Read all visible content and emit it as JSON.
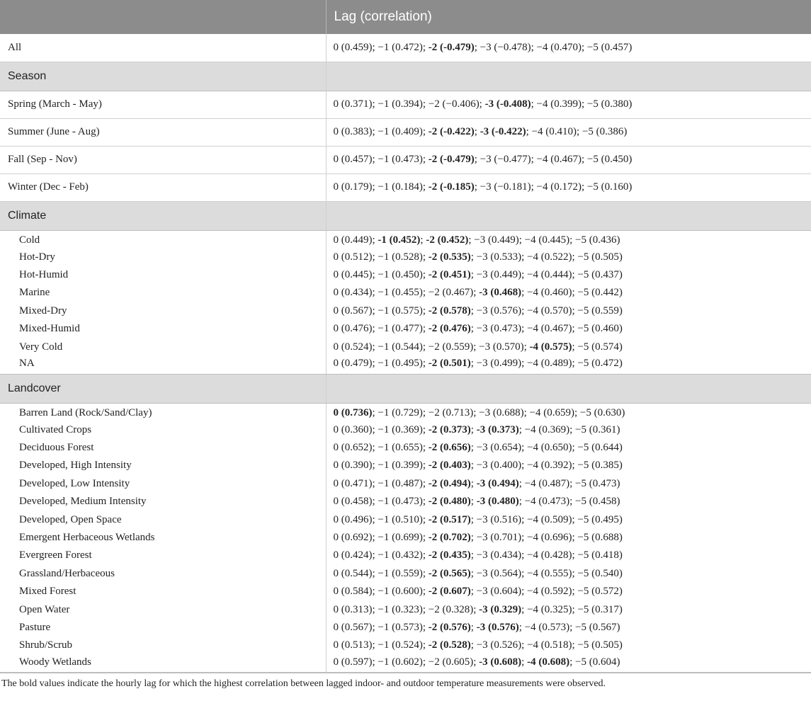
{
  "table": {
    "header": {
      "col1": "",
      "col2": "Lag (correlation)"
    },
    "sections": [
      {
        "title": "",
        "style": "row",
        "rows": [
          {
            "label": "All",
            "value": [
              {
                "t": "0 (0.459); −1 (0.472); "
              },
              {
                "t": "-2 (-0.479)",
                "b": true
              },
              {
                "t": "; −3 (−0.478); −4 (0.470); −5 (0.457)"
              }
            ]
          }
        ]
      },
      {
        "title": "Season",
        "style": "row",
        "rows": [
          {
            "label": "Spring (March - May)",
            "value": [
              {
                "t": "0 (0.371); −1 (0.394); −2 (−0.406); "
              },
              {
                "t": "-3 (-0.408)",
                "b": true
              },
              {
                "t": "; −4 (0.399); −5 (0.380)"
              }
            ]
          },
          {
            "label": "Summer (June - Aug)",
            "value": [
              {
                "t": "0 (0.383); −1 (0.409); "
              },
              {
                "t": "-2 (-0.422)",
                "b": true
              },
              {
                "t": "; "
              },
              {
                "t": "-3 (-0.422)",
                "b": true
              },
              {
                "t": "; −4 (0.410); −5 (0.386)"
              }
            ]
          },
          {
            "label": "Fall (Sep - Nov)",
            "value": [
              {
                "t": "0 (0.457); −1 (0.473); "
              },
              {
                "t": "-2 (-0.479)",
                "b": true
              },
              {
                "t": "; −3 (−0.477); −4 (0.467); −5 (0.450)"
              }
            ]
          },
          {
            "label": "Winter (Dec - Feb)",
            "value": [
              {
                "t": "0 (0.179); −1 (0.184); "
              },
              {
                "t": "-2 (-0.185)",
                "b": true
              },
              {
                "t": "; −3 (−0.181); −4 (0.172); −5 (0.160)"
              }
            ]
          }
        ]
      },
      {
        "title": "Climate",
        "style": "sub",
        "rows": [
          {
            "label": "Cold",
            "value": [
              {
                "t": "0 (0.449); "
              },
              {
                "t": "-1 (0.452)",
                "b": true
              },
              {
                "t": "; "
              },
              {
                "t": "-2 (0.452)",
                "b": true
              },
              {
                "t": "; −3 (0.449); −4 (0.445); −5 (0.436)"
              }
            ]
          },
          {
            "label": "Hot-Dry",
            "value": [
              {
                "t": "0 (0.512); −1 (0.528); "
              },
              {
                "t": "-2 (0.535)",
                "b": true
              },
              {
                "t": "; −3 (0.533); −4 (0.522); −5 (0.505)"
              }
            ]
          },
          {
            "label": "Hot-Humid",
            "value": [
              {
                "t": "0 (0.445); −1 (0.450); "
              },
              {
                "t": "-2 (0.451)",
                "b": true
              },
              {
                "t": "; −3 (0.449); −4 (0.444); −5 (0.437)"
              }
            ]
          },
          {
            "label": "Marine",
            "value": [
              {
                "t": "0 (0.434); −1 (0.455); −2 (0.467); "
              },
              {
                "t": "-3 (0.468)",
                "b": true
              },
              {
                "t": "; −4 (0.460); −5 (0.442)"
              }
            ]
          },
          {
            "label": "Mixed-Dry",
            "value": [
              {
                "t": "0 (0.567); −1 (0.575); "
              },
              {
                "t": "-2 (0.578)",
                "b": true
              },
              {
                "t": "; −3 (0.576); −4 (0.570); −5 (0.559)"
              }
            ]
          },
          {
            "label": "Mixed-Humid",
            "value": [
              {
                "t": "0 (0.476); −1 (0.477); "
              },
              {
                "t": "-2 (0.476)",
                "b": true
              },
              {
                "t": "; −3 (0.473); −4 (0.467); −5 (0.460)"
              }
            ]
          },
          {
            "label": "Very Cold",
            "value": [
              {
                "t": "0 (0.524); −1 (0.544); −2 (0.559); −3 (0.570); "
              },
              {
                "t": "-4 (0.575)",
                "b": true
              },
              {
                "t": "; −5 (0.574)"
              }
            ]
          },
          {
            "label": "NA",
            "value": [
              {
                "t": "0 (0.479); −1 (0.495); "
              },
              {
                "t": "-2 (0.501)",
                "b": true
              },
              {
                "t": "; −3 (0.499); −4 (0.489); −5 (0.472)"
              }
            ]
          }
        ]
      },
      {
        "title": "Landcover",
        "style": "sub",
        "rows": [
          {
            "label": "Barren Land (Rock/Sand/Clay)",
            "value": [
              {
                "t": "0 (0.736)",
                "b": true
              },
              {
                "t": "; −1 (0.729); −2 (0.713); −3 (0.688); −4 (0.659); −5 (0.630)"
              }
            ]
          },
          {
            "label": "Cultivated Crops",
            "value": [
              {
                "t": "0 (0.360); −1 (0.369); "
              },
              {
                "t": "-2 (0.373)",
                "b": true
              },
              {
                "t": "; "
              },
              {
                "t": "-3 (0.373)",
                "b": true
              },
              {
                "t": "; −4 (0.369); −5 (0.361)"
              }
            ]
          },
          {
            "label": "Deciduous Forest",
            "value": [
              {
                "t": "0 (0.652); −1 (0.655); "
              },
              {
                "t": "-2 (0.656)",
                "b": true
              },
              {
                "t": "; −3 (0.654); −4 (0.650); −5 (0.644)"
              }
            ]
          },
          {
            "label": "Developed, High Intensity",
            "value": [
              {
                "t": "0 (0.390); −1 (0.399); "
              },
              {
                "t": "-2 (0.403)",
                "b": true
              },
              {
                "t": "; −3 (0.400); −4 (0.392); −5 (0.385)"
              }
            ]
          },
          {
            "label": "Developed, Low Intensity",
            "value": [
              {
                "t": "0 (0.471); −1 (0.487); "
              },
              {
                "t": "-2 (0.494)",
                "b": true
              },
              {
                "t": "; "
              },
              {
                "t": "-3 (0.494)",
                "b": true
              },
              {
                "t": "; −4 (0.487); −5 (0.473)"
              }
            ]
          },
          {
            "label": "Developed, Medium Intensity",
            "value": [
              {
                "t": "0 (0.458); −1 (0.473); "
              },
              {
                "t": "-2 (0.480)",
                "b": true
              },
              {
                "t": "; "
              },
              {
                "t": "-3 (0.480)",
                "b": true
              },
              {
                "t": "; −4 (0.473); −5 (0.458)"
              }
            ]
          },
          {
            "label": "Developed, Open Space",
            "value": [
              {
                "t": "0 (0.496); −1 (0.510); "
              },
              {
                "t": "-2 (0.517)",
                "b": true
              },
              {
                "t": "; −3 (0.516); −4 (0.509); −5 (0.495)"
              }
            ]
          },
          {
            "label": "Emergent Herbaceous Wetlands",
            "value": [
              {
                "t": "0 (0.692); −1 (0.699); "
              },
              {
                "t": "-2 (0.702)",
                "b": true
              },
              {
                "t": "; −3 (0.701); −4 (0.696); −5 (0.688)"
              }
            ]
          },
          {
            "label": "Evergreen Forest",
            "value": [
              {
                "t": "0 (0.424); −1 (0.432); "
              },
              {
                "t": "-2 (0.435)",
                "b": true
              },
              {
                "t": "; −3 (0.434); −4 (0.428); −5 (0.418)"
              }
            ]
          },
          {
            "label": "Grassland/Herbaceous",
            "value": [
              {
                "t": "0 (0.544); −1 (0.559); "
              },
              {
                "t": "-2 (0.565)",
                "b": true
              },
              {
                "t": "; −3 (0.564); −4 (0.555); −5 (0.540)"
              }
            ]
          },
          {
            "label": "Mixed Forest",
            "value": [
              {
                "t": "0 (0.584); −1 (0.600); "
              },
              {
                "t": "-2 (0.607)",
                "b": true
              },
              {
                "t": "; −3 (0.604); −4 (0.592); −5 (0.572)"
              }
            ]
          },
          {
            "label": "Open Water",
            "value": [
              {
                "t": "0 (0.313); −1 (0.323); −2 (0.328); "
              },
              {
                "t": "-3 (0.329)",
                "b": true
              },
              {
                "t": "; −4 (0.325); −5 (0.317)"
              }
            ]
          },
          {
            "label": "Pasture",
            "value": [
              {
                "t": "0 (0.567); −1 (0.573); "
              },
              {
                "t": "-2 (0.576)",
                "b": true
              },
              {
                "t": "; "
              },
              {
                "t": "-3 (0.576)",
                "b": true
              },
              {
                "t": "; −4 (0.573); −5 (0.567)"
              }
            ]
          },
          {
            "label": "Shrub/Scrub",
            "value": [
              {
                "t": "0 (0.513); −1 (0.524); "
              },
              {
                "t": "-2 (0.528)",
                "b": true
              },
              {
                "t": "; −3 (0.526); −4 (0.518); −5 (0.505)"
              }
            ]
          },
          {
            "label": "Woody Wetlands",
            "value": [
              {
                "t": "0 (0.597); −1 (0.602); −2 (0.605); "
              },
              {
                "t": "-3 (0.608)",
                "b": true
              },
              {
                "t": "; "
              },
              {
                "t": "-4 (0.608)",
                "b": true
              },
              {
                "t": "; −5 (0.604)"
              }
            ]
          }
        ]
      }
    ]
  },
  "footnote": "The bold values indicate the hourly lag for which the highest correlation between lagged indoor- and outdoor temperature measurements were observed."
}
